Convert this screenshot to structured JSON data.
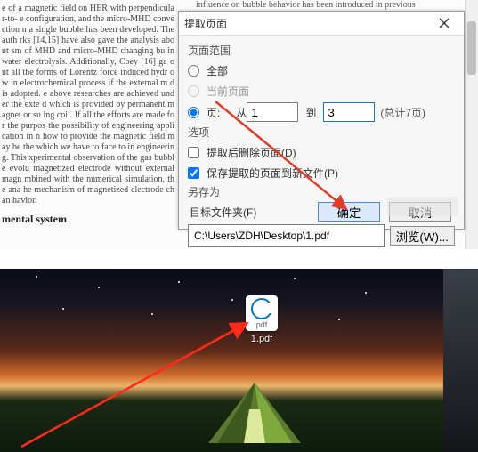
{
  "doc_left_text": "e of a magnetic field on HER with perpendicular-to-\ne configuration, and the micro-MHD convection\nn a single bubble has been developed. The auth\nrks [14,15] have also gave the analysis about\nsm of MHD and micro-MHD changing bu\nin water electrolysis. Additionally, Coey [16] ga\nout all the forms of Lorentz force induced hydr\now in electrochemical process if the external m\nd is adopted.\ne above researches are achieved under the exte\nd which is provided by permanent magnet or su\ning coil. If all the efforts are made for the purpos\nthe possibility of engineering application in\nn how to provide the magnetic field may be the\nwhich we have to face to in engineering. This\nxperimental observation of the gas bubble evolu\n magnetized electrode without external magn\nmbined with the numerical simulation, the ana\nhe mechanism of magnetized electrode chan\nhavior.",
  "doc_heading": "mental system",
  "doc_right_text": "influence on bubble behavior has been introduced in previous",
  "dialog": {
    "title": "提取页面",
    "section_range": "页面范围",
    "opt_all": "全部",
    "opt_current": "当前页面",
    "opt_pages": "页:",
    "from_label": "从",
    "from_value": "1",
    "to_label": "到",
    "to_value": "3",
    "total_hint": "(总计7页)",
    "section_options": "选项",
    "chk_delete_after": "提取后删除页面(D)",
    "chk_save_to_new": "保存提取的页面到新文件(P)",
    "section_saveas": "另存为",
    "folder_label": "目标文件夹(F)",
    "path_value": "C:\\Users\\ZDH\\Desktop\\1.pdf",
    "browse": "浏览(W)...",
    "ok": "确定",
    "cancel": "取消"
  },
  "desktop": {
    "file_label": "1.pdf",
    "pdf_text": "pdf"
  }
}
